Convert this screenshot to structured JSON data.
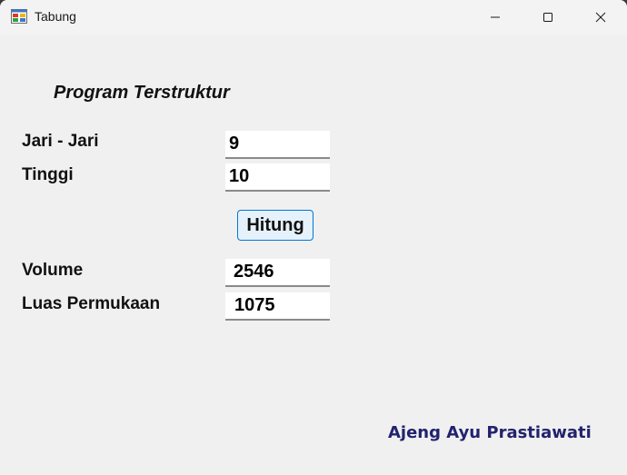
{
  "window": {
    "title": "Tabung",
    "app_icon": "winforms-app-icon",
    "controls": {
      "minimize_icon": "minimize-icon",
      "maximize_icon": "maximize-icon",
      "close_icon": "close-icon"
    }
  },
  "form": {
    "heading": "Program Terstruktur",
    "fields": {
      "jari_jari": {
        "label": "Jari - Jari",
        "value": "9"
      },
      "tinggi": {
        "label": "Tinggi",
        "value": "10"
      },
      "volume": {
        "label": "Volume",
        "value": "2546"
      },
      "luas_permukaan": {
        "label": "Luas Permukaan",
        "value": "1075"
      }
    },
    "hitung_button": "Hitung",
    "author": "Ajeng Ayu Prastiawati"
  },
  "colors": {
    "button_border": "#0078d4",
    "button_bg": "#e5f1fb",
    "author_text": "#22226e",
    "window_bg": "#f0f0f0"
  }
}
